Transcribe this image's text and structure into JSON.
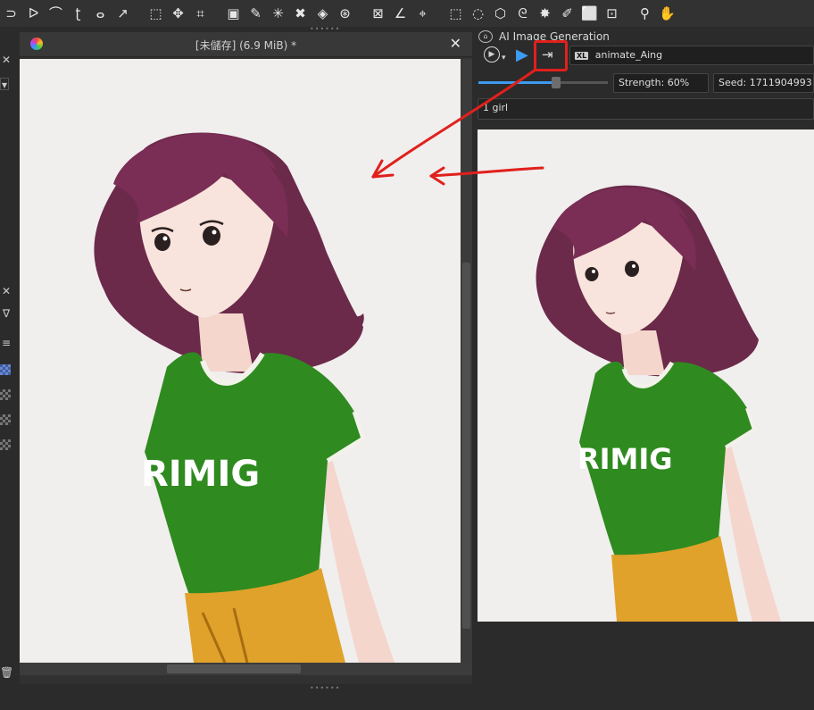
{
  "toolbar": {
    "icons": [
      {
        "name": "freehand-path-icon",
        "glyph": "⊃"
      },
      {
        "name": "polyline-icon",
        "glyph": "ᐅ"
      },
      {
        "name": "bezier-curve-icon",
        "glyph": "⌒"
      },
      {
        "name": "freehand-curve-icon",
        "glyph": "ʈ"
      },
      {
        "name": "dynamic-brush-icon",
        "glyph": "ⴰ"
      },
      {
        "name": "multibrush-icon",
        "glyph": "↗"
      },
      {
        "name": "sep"
      },
      {
        "name": "transform-icon",
        "glyph": "⬚"
      },
      {
        "name": "move-icon",
        "glyph": "✥"
      },
      {
        "name": "crop-icon",
        "glyph": "⌗"
      },
      {
        "name": "sep"
      },
      {
        "name": "gradient-icon",
        "glyph": "▣"
      },
      {
        "name": "color-picker-icon",
        "glyph": "✎"
      },
      {
        "name": "smart-patch-icon",
        "glyph": "✳"
      },
      {
        "name": "enclose-fill-icon",
        "glyph": "✖"
      },
      {
        "name": "fill-bucket-icon",
        "glyph": "◈"
      },
      {
        "name": "colorize-mask-icon",
        "glyph": "⊛"
      },
      {
        "name": "sep"
      },
      {
        "name": "assistant-icon",
        "glyph": "⊠"
      },
      {
        "name": "measure-icon",
        "glyph": "∠"
      },
      {
        "name": "reference-image-icon",
        "glyph": "⌖"
      },
      {
        "name": "sep"
      },
      {
        "name": "rect-select-icon",
        "glyph": "⬚"
      },
      {
        "name": "ellipse-select-icon",
        "glyph": "◌"
      },
      {
        "name": "polygon-select-icon",
        "glyph": "⬡"
      },
      {
        "name": "freehand-select-icon",
        "glyph": "ᘓ"
      },
      {
        "name": "contiguous-select-icon",
        "glyph": "✸"
      },
      {
        "name": "similar-select-icon",
        "glyph": "✐"
      },
      {
        "name": "bezier-select-icon",
        "glyph": "⬜"
      },
      {
        "name": "magnetic-select-icon",
        "glyph": "⊡"
      },
      {
        "name": "sep"
      },
      {
        "name": "zoom-icon",
        "glyph": "⚲"
      },
      {
        "name": "pan-icon",
        "glyph": "✋"
      }
    ]
  },
  "document": {
    "title": "[未儲存]  (6.9 MiB) *",
    "close_glyph": "✕"
  },
  "ai_docker": {
    "title": "AI Image Generation",
    "model_badge": "XL",
    "model_name": "animate_Aing",
    "strength": "Strength: 60%",
    "strength_fraction": 0.6,
    "seed": "Seed: 1711904993",
    "prompt": "1 girl"
  },
  "artwork": {
    "shirt_text": "RIMIG"
  },
  "colors": {
    "accent": "#e0201c",
    "generate_blue": "#3d9bf0",
    "shirt_green": "#2f8a1f",
    "hair": "#6b2a4a",
    "skirt": "#e0a22a"
  }
}
